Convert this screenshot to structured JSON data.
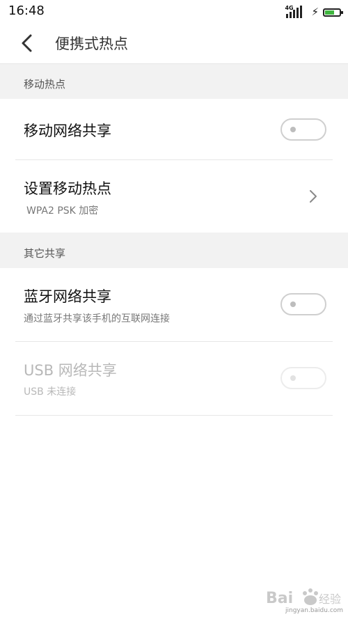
{
  "status_bar": {
    "time": "16:48",
    "network_type": "4G",
    "battery_color": "#3fb53f"
  },
  "header": {
    "title": "便携式热点",
    "back_icon": "chevron-left-icon"
  },
  "sections": [
    {
      "label": "移动热点",
      "rows": [
        {
          "title": "移动网络共享",
          "toggle_on": false
        },
        {
          "title": "设置移动热点",
          "subtitle": "WPA2 PSK 加密",
          "icon": "chevron-right-icon"
        }
      ]
    },
    {
      "label": "其它共享",
      "rows": [
        {
          "title": "蓝牙网络共享",
          "subtitle": "通过蓝牙共享该手机的互联网连接",
          "toggle_on": false
        },
        {
          "title": "USB 网络共享",
          "subtitle": "USB 未连接",
          "toggle_on": false,
          "disabled": true
        }
      ]
    }
  ],
  "watermark": {
    "logo_text": "Bai经验",
    "url": "jingyan.baidu.com"
  }
}
